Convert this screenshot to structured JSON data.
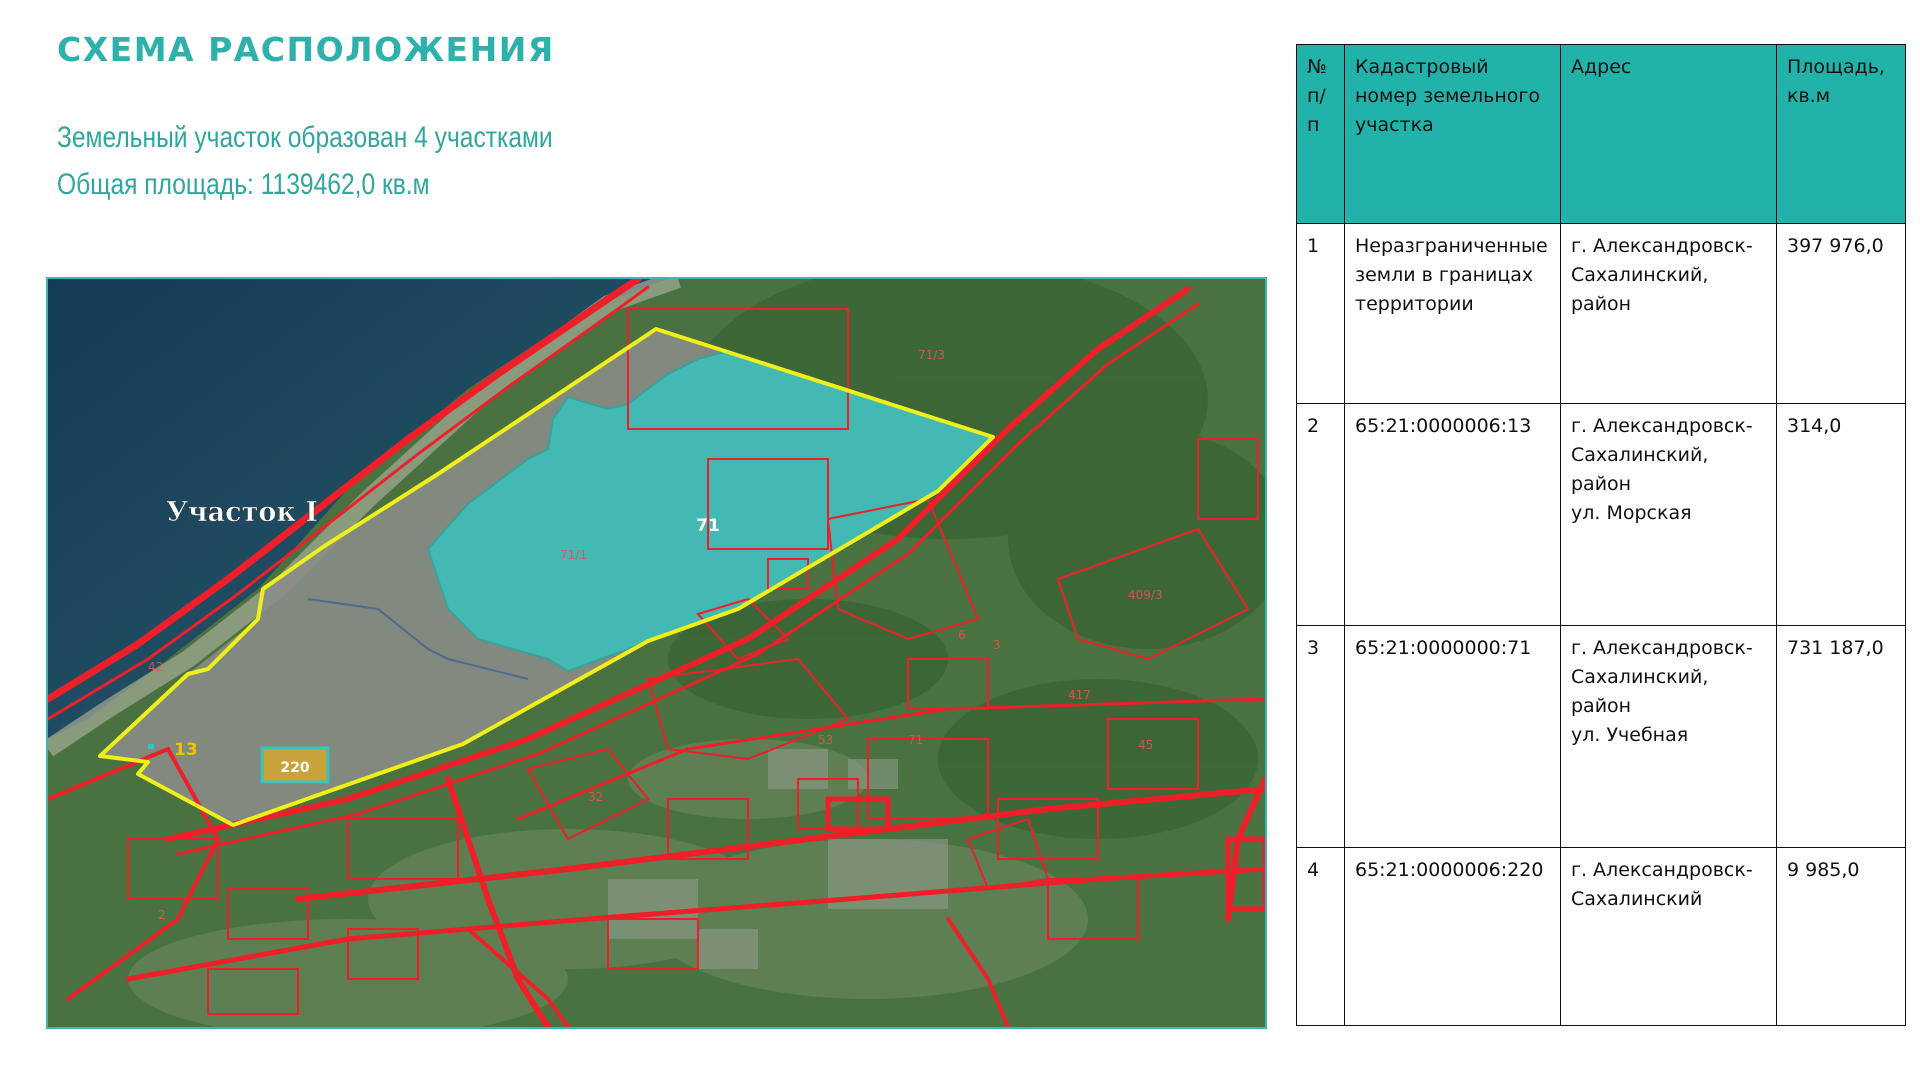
{
  "title": "СХЕМА РАСПОЛОЖЕНИЯ",
  "subtitle_line1": "Земельный участок образован 4 участками",
  "subtitle_line2": "Общая площадь: 1139462,0 кв.м",
  "map": {
    "area_label": "Участок I",
    "parcel_labels": [
      "71",
      "13",
      "220"
    ],
    "faint_labels": [
      "71/3",
      "71/1",
      "42",
      "409/3",
      "417",
      "3",
      "53",
      "32",
      "71",
      "6",
      "45",
      "2"
    ],
    "colors": {
      "boundary": "#f1ef1a",
      "parcel_71": "#35c4be",
      "cadastral_lines": "#ee1f28",
      "water": "#1f4a63",
      "vegetation": "#3d6a3a"
    }
  },
  "table": {
    "headers": [
      "№ п/п",
      "Кадастровый номер земельного участка",
      "Адрес",
      "Площадь, кв.м"
    ],
    "rows": [
      {
        "n": "1",
        "cadastral": "Неразграниченные земли в границах территории",
        "address": "г. Александровск-Сахалинский, район",
        "area": "397 976,0"
      },
      {
        "n": "2",
        "cadastral": "65:21:0000006:13",
        "address": "г. Александровск-Сахалинский, район\n ул. Морская",
        "area": "314,0"
      },
      {
        "n": "3",
        "cadastral": "65:21:0000000:71",
        "address": "г. Александровск-Сахалинский, район\nул. Учебная",
        "area": "731 187,0"
      },
      {
        "n": "4",
        "cadastral": "65:21:0000006:220",
        "address": "г. Александровск-Сахалинский",
        "area": "9 985,0"
      }
    ]
  }
}
